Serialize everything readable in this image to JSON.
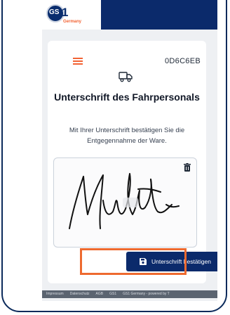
{
  "header": {
    "logo": {
      "text": "GS1",
      "subtext": "Germany"
    }
  },
  "card": {
    "code": "0D6C6EB",
    "title": "Unterschrift des Fahrpersonals",
    "description": "Mit Ihrer Unterschrift bestätigen Sie die Entgegennahme der Ware.",
    "confirm_label": "Unterschrift bestätigen"
  },
  "footer": {
    "links": [
      "Impressum",
      "Datenschutz",
      "AGB",
      "GS1",
      "GS1 Germany - powered by T"
    ]
  },
  "colors": {
    "navy": "#0b2a6b",
    "accent_orange": "#ee6a2f",
    "background": "#eef0f3"
  },
  "icons": [
    "menu-icon",
    "truck-icon",
    "trash-icon",
    "save-icon"
  ]
}
